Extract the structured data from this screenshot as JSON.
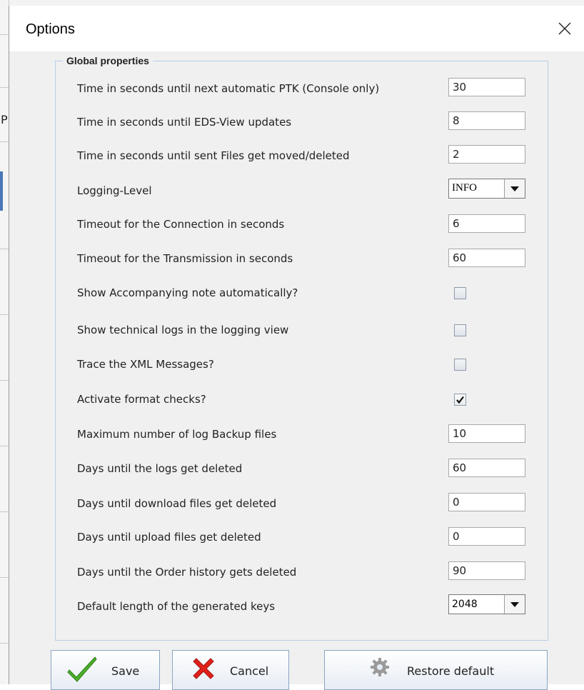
{
  "dialog": {
    "title": "Options",
    "group_title": "Global properties"
  },
  "settings": {
    "ptk_label": "Time in seconds until next automatic PTK (Console only)",
    "ptk_value": "30",
    "eds_label": "Time in seconds until EDS-View updates",
    "eds_value": "8",
    "sent_label": "Time in seconds until sent Files get moved/deleted",
    "sent_value": "2",
    "logging_label": "Logging-Level",
    "logging_value": "INFO",
    "conn_label": "Timeout for the Connection in seconds",
    "conn_value": "6",
    "trans_label": "Timeout for the Transmission in seconds",
    "trans_value": "60",
    "accomp_label": "Show Accompanying note automatically?",
    "accomp_checked": false,
    "techlogs_label": "Show technical logs in the logging view",
    "techlogs_checked": false,
    "xml_label": "Trace the XML Messages?",
    "xml_checked": false,
    "format_label": "Activate format checks?",
    "format_checked": true,
    "backup_label": "Maximum number of log Backup files",
    "backup_value": "10",
    "logsdel_label": "Days until the logs get deleted",
    "logsdel_value": "60",
    "download_label": "Days until download files get deleted",
    "download_value": "0",
    "upload_label": "Days until upload files get deleted",
    "upload_value": "0",
    "order_label": "Days until the Order history gets deleted",
    "order_value": "90",
    "keylen_label": "Default length of the generated keys",
    "keylen_value": "2048"
  },
  "buttons": {
    "save": "Save",
    "cancel": "Cancel",
    "restore": "Restore default"
  },
  "colors": {
    "dialog_bg": "#f0f0f0",
    "group_border": "#b8cfe5",
    "save_icon": "#4caf2a",
    "cancel_icon": "#e0201b"
  }
}
